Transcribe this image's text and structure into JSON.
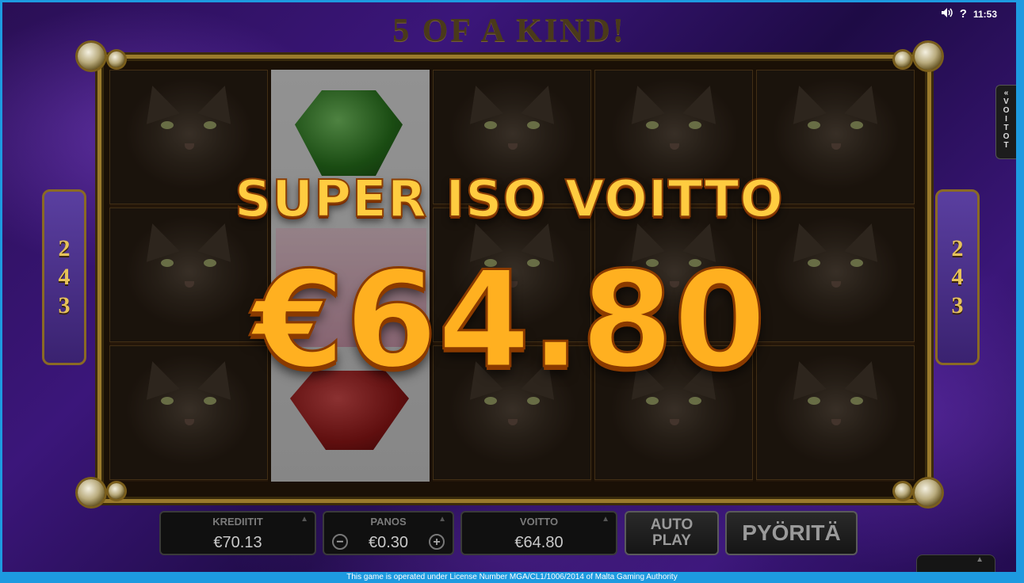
{
  "header": {
    "title": "5 OF A KIND!"
  },
  "status_bar": {
    "sound_icon": "speaker-icon",
    "help": "?",
    "clock": "11:53"
  },
  "side_panels": {
    "left_digits": [
      "2",
      "4",
      "3"
    ],
    "right_digits": [
      "2",
      "4",
      "3"
    ]
  },
  "wins_tab": {
    "arrow": "«",
    "letters": [
      "V",
      "O",
      "I",
      "T",
      "O",
      "T"
    ]
  },
  "win_overlay": {
    "title": "SUPER ISO VOITTO",
    "amount": "€64.80"
  },
  "bottom_bar": {
    "credits": {
      "label": "KREDIITIT",
      "value": "€70.13"
    },
    "bet": {
      "label": "PANOS",
      "value": "€0.30",
      "minus": "−",
      "plus": "+"
    },
    "win": {
      "label": "VOITTO",
      "value": "€64.80"
    },
    "autoplay_label": "AUTO PLAY",
    "spin_label": "PYÖRITÄ"
  },
  "license_text": "This game is operated under License Number MGA/CL1/1006/2014 of Malta Gaming Authority",
  "reels": {
    "symbols": [
      [
        "cat",
        "cat",
        "cat"
      ],
      [
        "green-gem",
        "seven",
        "red-gem"
      ],
      [
        "cat",
        "cat",
        "cat"
      ],
      [
        "cat",
        "cat",
        "cat"
      ],
      [
        "cat",
        "cat",
        "cat"
      ]
    ]
  },
  "colors": {
    "gold": "#ffcc40",
    "frame": "#9a7a2c",
    "background": "#2a0f55",
    "border": "#1d9ae0"
  }
}
